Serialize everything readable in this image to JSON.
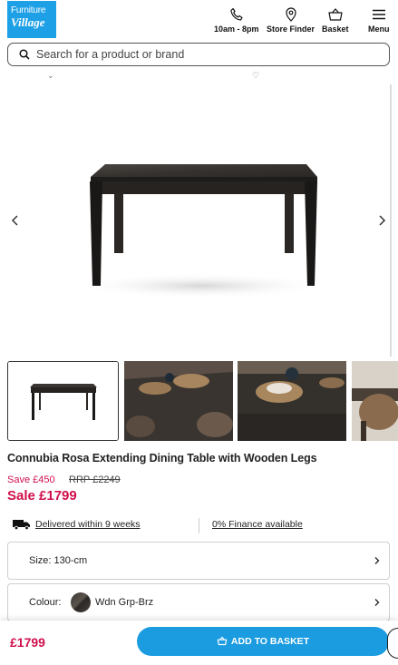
{
  "brand": {
    "logo_line1": "Furniture",
    "logo_line2": "Village"
  },
  "header": {
    "hours_label": "10am - 8pm",
    "store_finder_label": "Store Finder",
    "basket_label": "Basket",
    "menu_label": "Menu"
  },
  "search": {
    "placeholder": "Search for a product or brand"
  },
  "gallery": {
    "thumbnail_count_visible": 4
  },
  "product": {
    "title": "Connubia Rosa Extending Dining Table with Wooden Legs",
    "save_text": "Save £450",
    "rrp_text": "RRP £2249",
    "sale_text": "Sale £1799",
    "delivery_text": "Delivered within 9 weeks",
    "finance_text": "0% Finance available",
    "size_label": "Size: 130-cm",
    "colour_label": "Colour:",
    "colour_value": "Wdn Grp-Brz"
  },
  "bottom_bar": {
    "price": "£1799",
    "add_label": "ADD TO BASKET"
  },
  "colors": {
    "brand_blue": "#1c9ce0",
    "sale_red": "#d0104c"
  }
}
